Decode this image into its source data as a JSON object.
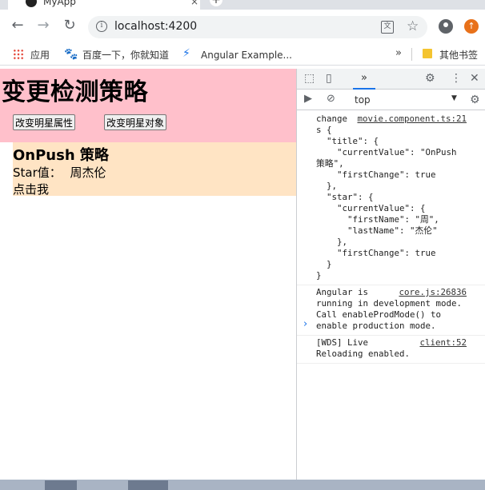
{
  "browser": {
    "tab_title": "MyApp",
    "tab_close": "×",
    "new_tab": "+",
    "url": "localhost:4200",
    "bookmarks": [
      {
        "label": "应用"
      },
      {
        "label": "百度一下，你就知道"
      },
      {
        "label": "Angular Example..."
      }
    ],
    "bookmarks_more": "»",
    "other_bookmarks": "其他书签"
  },
  "page": {
    "title": "变更检测策略",
    "btn_change_prop": "改变明星属性",
    "btn_change_obj": "改变明星对象",
    "child_title": "OnPush 策略",
    "child_star_label": "Star值：",
    "child_star_value": "周杰伦",
    "child_click": "点击我"
  },
  "devtools": {
    "more_tabs": "»",
    "context": "top",
    "console": [
      {
        "source": "movie.component.ts:21",
        "text": "change\ns {\n  \"title\": {\n    \"currentValue\": \"OnPush\n策略\",\n    \"firstChange\": true\n  },\n  \"star\": {\n    \"currentValue\": {\n      \"firstName\": \"周\",\n      \"lastName\": \"杰伦\"\n    },\n    \"firstChange\": true\n  }\n}"
      },
      {
        "source": "core.js:26836",
        "text": "Angular is\nrunning in development mode.\nCall enableProdMode() to\nenable production mode."
      },
      {
        "source": "client:52",
        "text": "[WDS] Live\nReloading enabled."
      }
    ],
    "prompt": "›"
  }
}
